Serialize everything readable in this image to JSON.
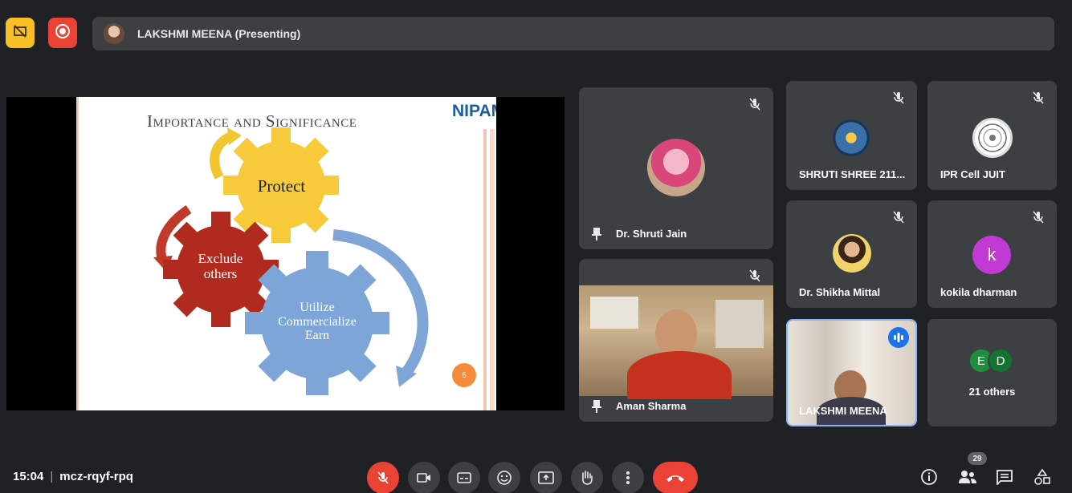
{
  "header": {
    "presenter_label": "LAKSHMI MEENA (Presenting)"
  },
  "slide": {
    "title": "Importance and Significance",
    "logo": "NIPAM",
    "gears": {
      "protect": "Protect",
      "exclude_line1": "Exclude",
      "exclude_line2": "others",
      "utilize_line1": "Utilize",
      "utilize_line2": "Commercialize",
      "utilize_line3": "Earn"
    },
    "page_number": "5"
  },
  "participants": [
    {
      "name": "Dr. Shruti Jain",
      "muted": true,
      "pinned": true
    },
    {
      "name": "SHRUTI SHREE 211...",
      "muted": true
    },
    {
      "name": "IPR Cell JUIT",
      "muted": true
    },
    {
      "name": "Dr. Shikha Mittal",
      "muted": true
    },
    {
      "name": "kokila dharman",
      "muted": true,
      "avatar_letter": "k"
    },
    {
      "name": "Aman Sharma",
      "muted": true,
      "pinned": true
    },
    {
      "name": "LAKSHMI MEENA",
      "speaking": true
    }
  ],
  "others": {
    "avatar_letters": [
      "E",
      "D"
    ],
    "label": "21 others"
  },
  "footer": {
    "time": "15:04",
    "separator": "|",
    "meeting_code": "mcz-rqyf-rpq",
    "people_count": "29"
  },
  "colors": {
    "background": "#202124",
    "tile": "#3c4043",
    "danger": "#ea4335",
    "warning": "#f6bf26",
    "speaking_border": "#8ab4f8",
    "kokila_avatar": "#c13ad4",
    "e_avatar": "#1e8e3e",
    "d_avatar": "#137333"
  }
}
